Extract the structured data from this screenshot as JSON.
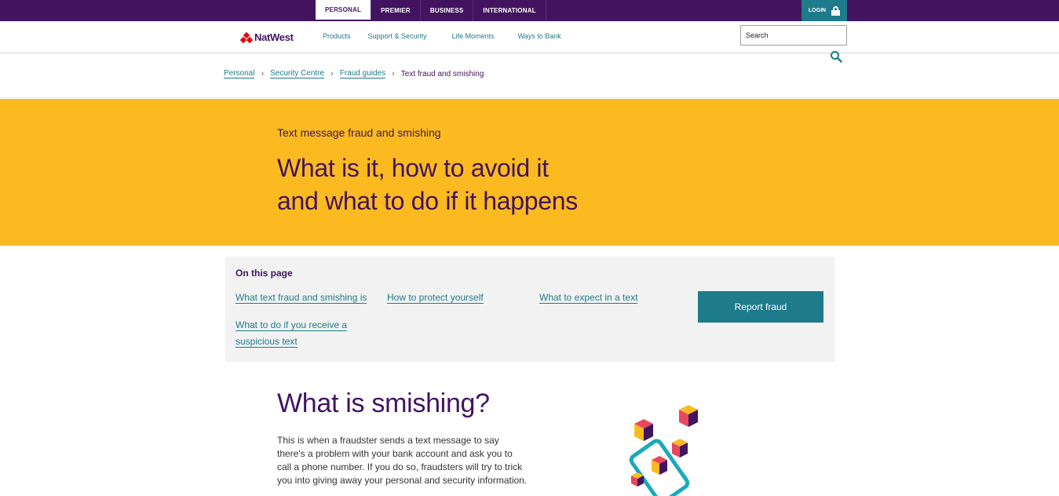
{
  "top_tabs": {
    "personal": "PERSONAL",
    "premier": "PREMIER",
    "business": "BUSINESS",
    "international": "INTERNATIONAL"
  },
  "login_label": "LOGIN",
  "brand": {
    "name": "NatWest",
    "color": "#42145f",
    "logo_color": "#e00b0e"
  },
  "nav": {
    "products": "Products",
    "support": "Support & Security",
    "life": "Life Moments",
    "ways": "Ways to Bank"
  },
  "search": {
    "placeholder": "Search",
    "icon": "search-icon"
  },
  "breadcrumb": {
    "personal": "Personal",
    "security": "Security Centre",
    "fraud": "Fraud guides",
    "current": "Text fraud and smishing"
  },
  "hero": {
    "kicker": "Text message fraud and smishing",
    "title_line1": "What is it, how to avoid it",
    "title_line2": "and what to do if it happens",
    "bg_color": "#fbba20"
  },
  "on_this_page": {
    "title": "On this page",
    "link1": "What text fraud and smishing is",
    "link2": "How to protect yourself",
    "link3": "What to expect in a text",
    "link4_line1": "What to do if you receive a",
    "link4_line2": "suspicious text",
    "report_button": "Report fraud",
    "accent_color": "#1d7b8a"
  },
  "section": {
    "title": "What is smishing?",
    "body": "This is when a fraudster sends a text message to say there's a problem with your bank account and ask you to call a phone number. If you do so, fraudsters will try to trick you into giving away your personal and security information."
  }
}
